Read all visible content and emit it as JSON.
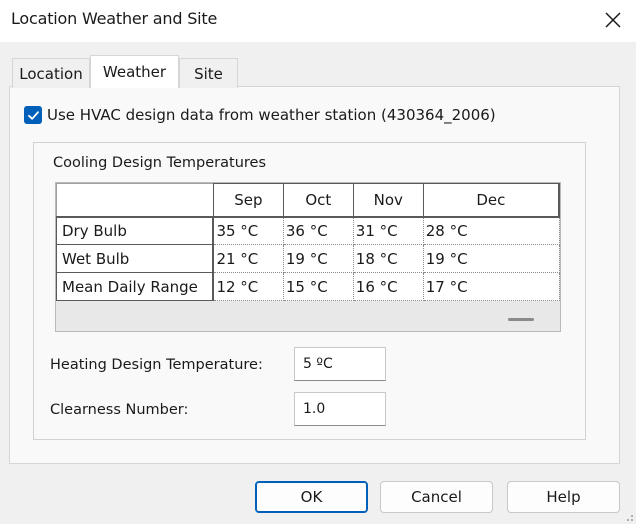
{
  "window": {
    "title": "Location Weather and Site"
  },
  "tabs": [
    {
      "label": "Location",
      "active": false
    },
    {
      "label": "Weather",
      "active": true
    },
    {
      "label": "Site",
      "active": false
    }
  ],
  "weather": {
    "use_hvac_checkbox": {
      "label": "Use HVAC design data from weather station (430364_2006)",
      "checked": true
    },
    "cooling": {
      "group_title": "Cooling Design Temperatures",
      "columns": [
        "Sep",
        "Oct",
        "Nov",
        "Dec"
      ],
      "rows": [
        {
          "label": "Dry Bulb",
          "values": [
            "35 °C",
            "36 °C",
            "31 °C",
            "28 °C"
          ]
        },
        {
          "label": "Wet Bulb",
          "values": [
            "21 °C",
            "19 °C",
            "18 °C",
            "19 °C"
          ]
        },
        {
          "label": "Mean Daily Range",
          "values": [
            "12 °C",
            "15 °C",
            "16 °C",
            "17 °C"
          ]
        }
      ]
    },
    "heating": {
      "label": "Heating Design Temperature:",
      "value": "5 ºC"
    },
    "clearness": {
      "label": "Clearness Number:",
      "value": "1.0"
    }
  },
  "buttons": {
    "ok": "OK",
    "cancel": "Cancel",
    "help": "Help"
  },
  "colors": {
    "accent": "#005fb8",
    "background": "#f0f0f0",
    "panel": "#f9f9f9"
  },
  "icons": {
    "close": "close-icon",
    "check": "checkmark-icon",
    "grip": "resize-grip-icon"
  }
}
